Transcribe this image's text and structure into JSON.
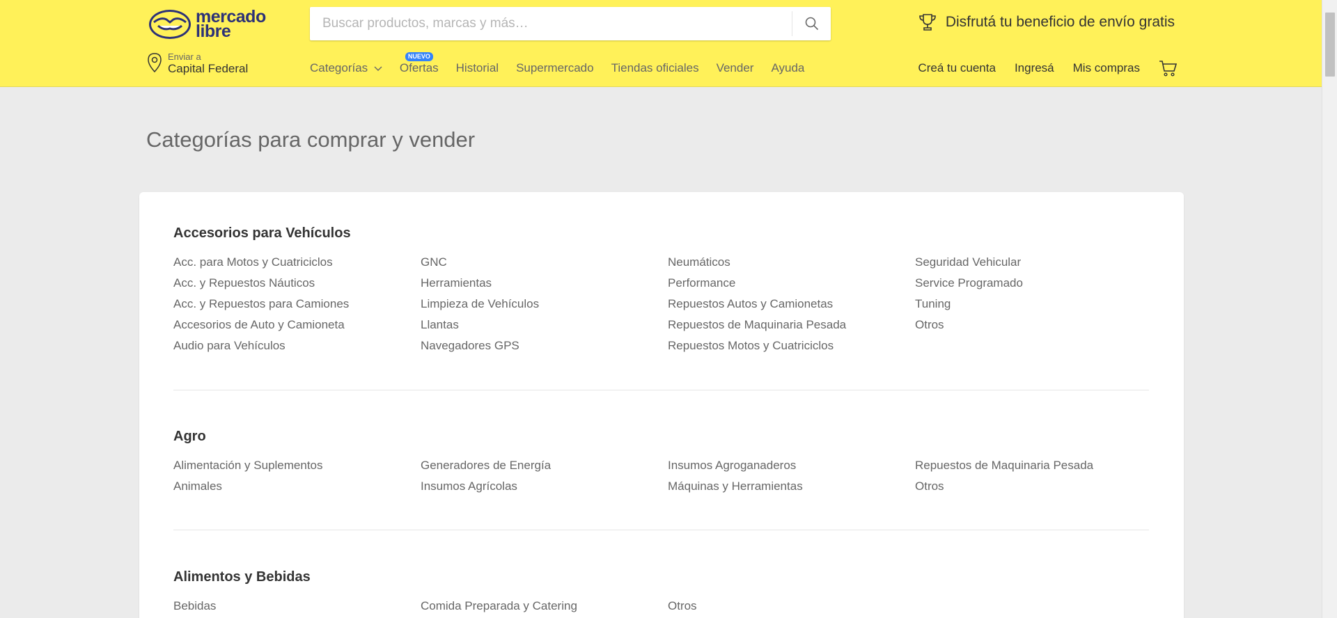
{
  "header": {
    "logo_line1": "mercado",
    "logo_line2": "libre",
    "search_placeholder": "Buscar productos, marcas y más…",
    "promo_text": "Disfrutá tu beneficio de envío gratis",
    "location_label": "Enviar a",
    "location_value": "Capital Federal",
    "nav": [
      {
        "label": "Categorías"
      },
      {
        "label": "Ofertas",
        "badge": "NUEVO"
      },
      {
        "label": "Historial"
      },
      {
        "label": "Supermercado"
      },
      {
        "label": "Tiendas oficiales"
      },
      {
        "label": "Vender"
      },
      {
        "label": "Ayuda"
      }
    ],
    "account": {
      "create": "Creá tu cuenta",
      "login": "Ingresá",
      "purchases": "Mis compras"
    },
    "colors": {
      "brand_yellow": "#fff159",
      "logo_blue": "#2d3277",
      "badge_blue": "#3483fa"
    }
  },
  "page_title": "Categorías para comprar y vender",
  "categories": [
    {
      "title": "Accesorios para Vehículos",
      "columns": [
        [
          "Acc. para Motos y Cuatriciclos",
          "Acc. y Repuestos Náuticos",
          "Acc. y Repuestos para Camiones",
          "Accesorios de Auto y Camioneta",
          "Audio para Vehículos"
        ],
        [
          "GNC",
          "Herramientas",
          "Limpieza de Vehículos",
          "Llantas",
          "Navegadores GPS"
        ],
        [
          "Neumáticos",
          "Performance",
          "Repuestos Autos y Camionetas",
          "Repuestos de Maquinaria Pesada",
          "Repuestos Motos y Cuatriciclos"
        ],
        [
          "Seguridad Vehicular",
          "Service Programado",
          "Tuning",
          "Otros"
        ]
      ]
    },
    {
      "title": "Agro",
      "columns": [
        [
          "Alimentación y Suplementos",
          "Animales"
        ],
        [
          "Generadores de Energía",
          "Insumos Agrícolas"
        ],
        [
          "Insumos Agroganaderos",
          "Máquinas y Herramientas"
        ],
        [
          "Repuestos de Maquinaria Pesada",
          "Otros"
        ]
      ]
    },
    {
      "title": "Alimentos y Bebidas",
      "columns": [
        [
          "Bebidas"
        ],
        [
          "Comida Preparada y Catering"
        ],
        [
          "Otros"
        ],
        []
      ]
    }
  ]
}
